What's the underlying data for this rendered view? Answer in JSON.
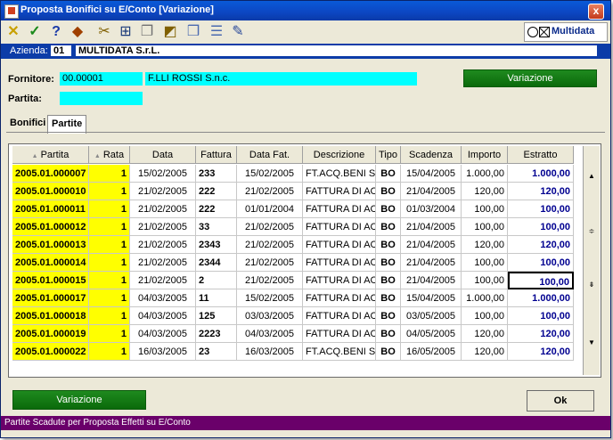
{
  "window": {
    "title": "Proposta Bonifici su E/Conto [Variazione]",
    "close_label": "x"
  },
  "toolbar": {
    "icons": [
      "cancel-icon",
      "confirm-icon",
      "help-icon",
      "tag-icon",
      "scissors-icon",
      "binoculars-icon",
      "copy-icon",
      "edit-icon",
      "windows-icon",
      "list-icon",
      "note-icon"
    ],
    "logo_text": "Multidata"
  },
  "azienda": {
    "label": "Azienda:",
    "code": "01",
    "name": "MULTIDATA S.r.L."
  },
  "form": {
    "fornitore_label": "Fornitore:",
    "fornitore_code": "00.00001",
    "fornitore_name": "F.LLI ROSSI S.n.c.",
    "partita_label": "Partita:",
    "partita_value": "",
    "variazione_label": "Variazione"
  },
  "tabs": [
    {
      "label": "Bonifici",
      "active": false
    },
    {
      "label": "Partite",
      "active": true
    }
  ],
  "table": {
    "columns": [
      "Partita",
      "Rata",
      "Data",
      "Fattura",
      "Data Fat.",
      "Descrizione",
      "Tipo",
      "Scadenza",
      "Importo",
      "Estratto"
    ],
    "rows": [
      [
        "2005.01.000007",
        "1",
        "15/02/2005",
        "233",
        "15/02/2005",
        "FT.ACQ.BENI ST",
        "BO",
        "15/04/2005",
        "1.000,00",
        "1.000,00"
      ],
      [
        "2005.01.000010",
        "1",
        "21/02/2005",
        "222",
        "21/02/2005",
        "FATTURA DI AC",
        "BO",
        "21/04/2005",
        "120,00",
        "120,00"
      ],
      [
        "2005.01.000011",
        "1",
        "21/02/2005",
        "222",
        "01/01/2004",
        "FATTURA DI AC",
        "BO",
        "01/03/2004",
        "100,00",
        "100,00"
      ],
      [
        "2005.01.000012",
        "1",
        "21/02/2005",
        "33",
        "21/02/2005",
        "FATTURA DI AC",
        "BO",
        "21/04/2005",
        "100,00",
        "100,00"
      ],
      [
        "2005.01.000013",
        "1",
        "21/02/2005",
        "2343",
        "21/02/2005",
        "FATTURA DI AC",
        "BO",
        "21/04/2005",
        "120,00",
        "120,00"
      ],
      [
        "2005.01.000014",
        "1",
        "21/02/2005",
        "2344",
        "21/02/2005",
        "FATTURA DI AC",
        "BO",
        "21/04/2005",
        "100,00",
        "100,00"
      ],
      [
        "2005.01.000015",
        "1",
        "21/02/2005",
        "2",
        "21/02/2005",
        "FATTURA DI AC",
        "BO",
        "21/04/2005",
        "100,00",
        "100,00"
      ],
      [
        "2005.01.000017",
        "1",
        "04/03/2005",
        "11",
        "15/02/2005",
        "FATTURA DI AC",
        "BO",
        "15/04/2005",
        "1.000,00",
        "1.000,00"
      ],
      [
        "2005.01.000018",
        "1",
        "04/03/2005",
        "125",
        "03/03/2005",
        "FATTURA DI AC",
        "BO",
        "03/05/2005",
        "100,00",
        "100,00"
      ],
      [
        "2005.01.000019",
        "1",
        "04/03/2005",
        "2223",
        "04/03/2005",
        "FATTURA DI AC",
        "BO",
        "04/05/2005",
        "120,00",
        "120,00"
      ],
      [
        "2005.01.000022",
        "1",
        "16/03/2005",
        "23",
        "16/03/2005",
        "FT.ACQ.BENI ST",
        "BO",
        "16/05/2005",
        "120,00",
        "120,00"
      ]
    ],
    "selected_row": 6
  },
  "footer": {
    "variazione_label": "Variazione",
    "ok_label": "Ok"
  },
  "status": {
    "text": "Partite Scadute per Proposta Effetti su E/Conto"
  },
  "colors": {
    "titlebar": "#0c46c2",
    "highlight_yellow": "#ffff00",
    "field_cyan": "#00ffff",
    "button_green": "#0b6a0b",
    "status_purple": "#6a006a",
    "estratto_blue": "#000090"
  }
}
